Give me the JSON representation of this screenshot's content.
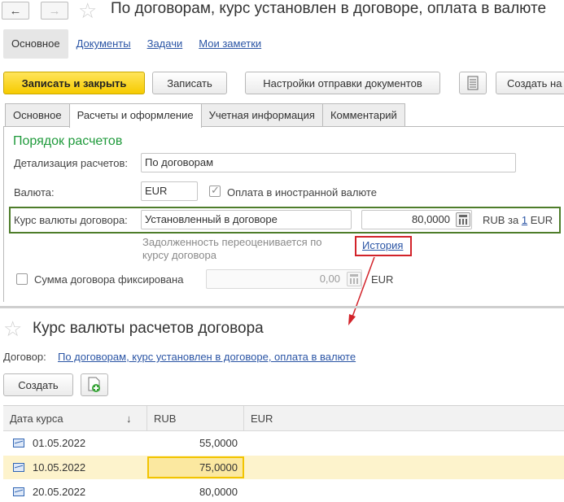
{
  "header": {
    "back": "←",
    "forward": "→",
    "star": "☆",
    "title": "По договорам, курс установлен в договоре, оплата в валюте"
  },
  "section_tabs": [
    "Основное",
    "Документы",
    "Задачи",
    "Мои заметки"
  ],
  "toolbar": {
    "save_close": "Записать и закрыть",
    "save": "Записать",
    "send_settings": "Настройки отправки документов",
    "create_based": "Создать на"
  },
  "form_tabs": [
    "Основное",
    "Расчеты и оформление",
    "Учетная информация",
    "Комментарий"
  ],
  "form": {
    "group_title": "Порядок расчетов",
    "detail_label": "Детализация расчетов:",
    "detail_value": "По договорам",
    "currency_label": "Валюта:",
    "currency_value": "EUR",
    "foreign_payment_label": "Оплата в иностранной валюте",
    "foreign_payment_checked": true,
    "rate_label": "Курс валюты договора:",
    "rate_mode": "Установленный в договоре",
    "rate_value": "80,0000",
    "rate_unit_prefix": "RUB за",
    "rate_unit_link": "1",
    "rate_unit_suffix": "EUR",
    "revaluation_note_line1": "Задолженность переоценивается по",
    "revaluation_note_line2": "курсу договора",
    "history_link": "История",
    "fixed_sum_label": "Сумма договора фиксирована",
    "fixed_sum_checked": false,
    "fixed_sum_value": "0,00",
    "fixed_sum_currency": "EUR"
  },
  "rates_window": {
    "star": "☆",
    "title": "Курс валюты расчетов договора",
    "contract_label": "Договор:",
    "contract_link": "По договорам, курс установлен в договоре, оплата в валюте",
    "create_button": "Создать",
    "columns": [
      "Дата курса",
      "RUB",
      "EUR"
    ],
    "sort_arrow": "↓",
    "rows": [
      {
        "date": "01.05.2022",
        "rub": "55,0000",
        "eur": "",
        "selected": false
      },
      {
        "date": "10.05.2022",
        "rub": "75,0000",
        "eur": "",
        "selected": true
      },
      {
        "date": "20.05.2022",
        "rub": "80,0000",
        "eur": "",
        "selected": false
      }
    ]
  },
  "colors": {
    "accent_yellow": "#f6cb00",
    "group_green": "#1f9a3b",
    "highlight_green": "#4e7d2a",
    "highlight_red": "#d2232a",
    "link_blue": "#2b55a5",
    "selected_row": "#fdf3cc"
  }
}
